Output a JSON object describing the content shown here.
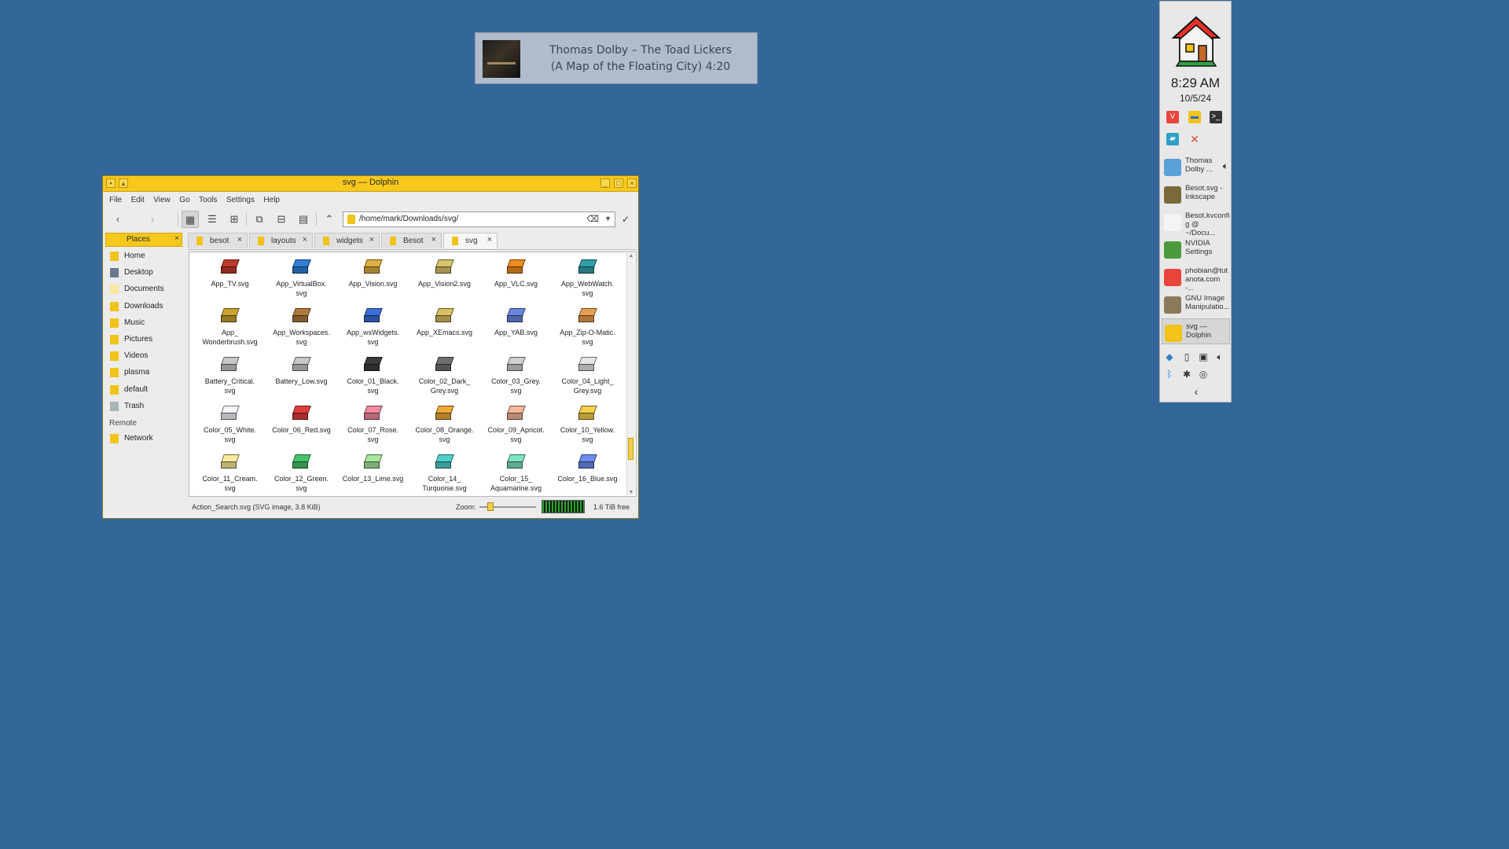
{
  "notification": {
    "line1": "Thomas Dolby – The Toad Lickers",
    "line2": "(A Map of the Floating City) 4:20"
  },
  "window": {
    "title": "svg — Dolphin",
    "menu": [
      "File",
      "Edit",
      "View",
      "Go",
      "Tools",
      "Settings",
      "Help"
    ],
    "location": "/home/mark/Downloads/svg/",
    "places_title": "Places",
    "places": [
      {
        "label": "Home",
        "icon": "home-icon",
        "color": "#f2c318"
      },
      {
        "label": "Desktop",
        "icon": "desktop-icon",
        "color": "#6a7a8a"
      },
      {
        "label": "Documents",
        "icon": "documents-icon",
        "color": "#f7e7a0"
      },
      {
        "label": "Downloads",
        "icon": "downloads-icon",
        "color": "#f2c318"
      },
      {
        "label": "Music",
        "icon": "music-icon",
        "color": "#f2c318"
      },
      {
        "label": "Pictures",
        "icon": "pictures-icon",
        "color": "#f2c318"
      },
      {
        "label": "Videos",
        "icon": "videos-icon",
        "color": "#f2c318"
      },
      {
        "label": "plasma",
        "icon": "folder-icon",
        "color": "#f2c318"
      },
      {
        "label": "default",
        "icon": "folder-icon",
        "color": "#f2c318"
      },
      {
        "label": "Trash",
        "icon": "trash-icon",
        "color": "#a9b4b4"
      }
    ],
    "remote_label": "Remote",
    "network_label": "Network",
    "tabs": [
      "besot",
      "layouts",
      "widgets",
      "Besot",
      "svg"
    ],
    "active_tab": "svg",
    "files": [
      {
        "name": "App_TV.svg",
        "color": "#c0392b"
      },
      {
        "name": "App_VirtualBox.\nsvg",
        "color": "#2f7fd8"
      },
      {
        "name": "App_Vision.svg",
        "color": "#e0b040"
      },
      {
        "name": "App_Vision2.svg",
        "color": "#d9c36a"
      },
      {
        "name": "App_VLC.svg",
        "color": "#f08c1c"
      },
      {
        "name": "App_WebWatch.\nsvg",
        "color": "#2fa0a8"
      },
      {
        "name": "App_\nWonderbrush.svg",
        "color": "#c9a12c"
      },
      {
        "name": "App_Workspaces.\nsvg",
        "color": "#b07a3c"
      },
      {
        "name": "App_wxWidgets.\nsvg",
        "color": "#3b6ed8"
      },
      {
        "name": "App_XEmacs.svg",
        "color": "#d8c060"
      },
      {
        "name": "App_YAB.svg",
        "color": "#6a86e0"
      },
      {
        "name": "App_Zip-O-Matic.\nsvg",
        "color": "#e8a050"
      },
      {
        "name": "Battery_Critical.\nsvg",
        "color": "#c8c8c8"
      },
      {
        "name": "Battery_Low.svg",
        "color": "#c8c8c8"
      },
      {
        "name": "Color_01_Black.\nsvg",
        "color": "#3a3a3a"
      },
      {
        "name": "Color_02_Dark_\nGrey.svg",
        "color": "#6e6e6e"
      },
      {
        "name": "Color_03_Grey.\nsvg",
        "color": "#cfcfcf"
      },
      {
        "name": "Color_04_Light_\nGrey.svg",
        "color": "#e6e6e6"
      },
      {
        "name": "Color_05_White.\nsvg",
        "color": "#f4f4fb"
      },
      {
        "name": "Color_06_Red.svg",
        "color": "#e23b3b"
      },
      {
        "name": "Color_07_Rose.\nsvg",
        "color": "#f28aa0"
      },
      {
        "name": "Color_08_Orange.\nsvg",
        "color": "#f0a838"
      },
      {
        "name": "Color_09_Apricot.\nsvg",
        "color": "#f7b89a"
      },
      {
        "name": "Color_10_Yellow.\nsvg",
        "color": "#f4d04a"
      },
      {
        "name": "Color_11_Cream.\nsvg",
        "color": "#f8ec9c"
      },
      {
        "name": "Color_12_Green.\nsvg",
        "color": "#46c46a"
      },
      {
        "name": "Color_13_Lime.svg",
        "color": "#a8e89c"
      },
      {
        "name": "Color_14_\nTurquoise.svg",
        "color": "#4fd0cc"
      },
      {
        "name": "Color_15_\nAquamarine.svg",
        "color": "#7ce4c0"
      },
      {
        "name": "Color_16_Blue.svg",
        "color": "#6c8ef0"
      }
    ],
    "status_message": "Action_Search.svg (SVG image, 3.8 KiB)",
    "zoom_label": "Zoom:",
    "zoom_level": 0.15,
    "free_space": "1.6 TiB free"
  },
  "panel": {
    "time": "8:29 AM",
    "date": "10/5/24",
    "tasks": [
      {
        "label": "Thomas\nDolby ...",
        "color": "#5aa0d8",
        "active": false
      },
      {
        "label": "Besot.svg -\nInkscape",
        "color": "#7a6a3a",
        "active": false
      },
      {
        "label": "Besot.kvconfi\ng @ ~/Docu...",
        "color": "#f4f4f4",
        "active": false
      },
      {
        "label": "NVIDIA\nSettings",
        "color": "#4c9a3c",
        "active": false
      },
      {
        "label": "phobian@tut\nanota.com -...",
        "color": "#e8443c",
        "active": false
      },
      {
        "label": "GNU Image\nManipulatio...",
        "color": "#8a7a5a",
        "active": false
      },
      {
        "label": "svg —\nDolphin",
        "color": "#f2c318",
        "active": true
      }
    ]
  }
}
